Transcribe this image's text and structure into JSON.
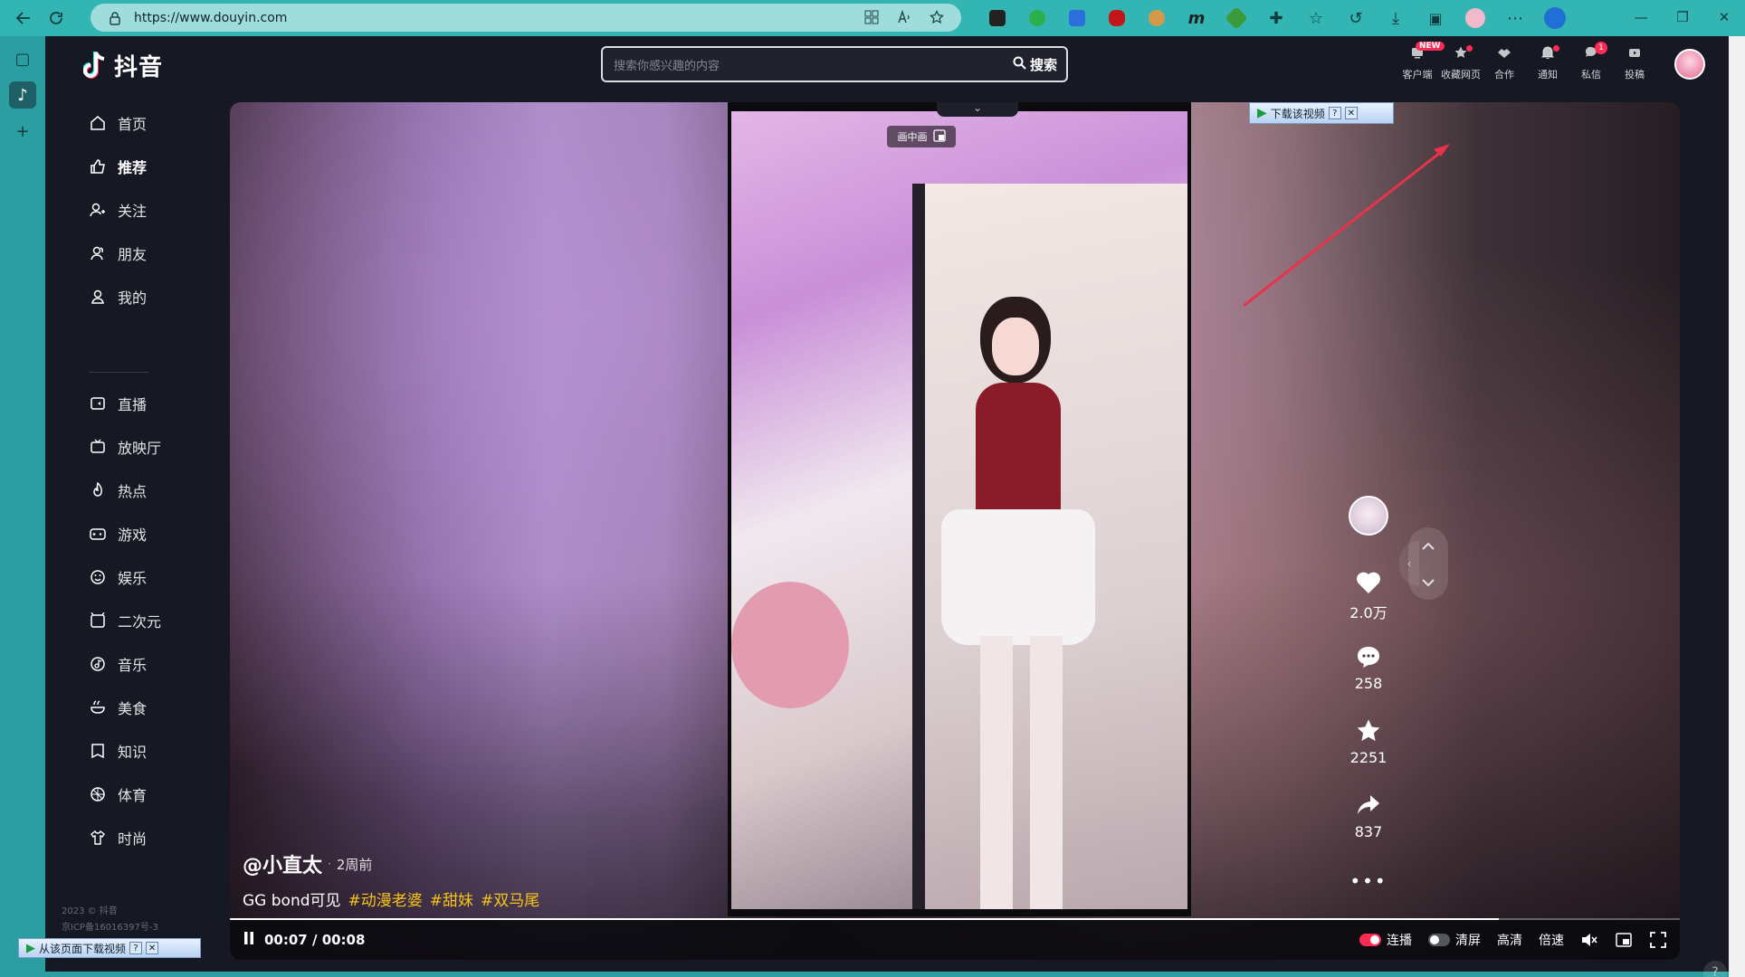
{
  "browser": {
    "url": "https://www.douyin.com"
  },
  "logo": {
    "text": "抖音"
  },
  "sidebar": {
    "items": [
      {
        "label": "首页",
        "icon": "home-icon"
      },
      {
        "label": "推荐",
        "icon": "thumbs-up-icon",
        "active": true
      },
      {
        "label": "关注",
        "icon": "follow-icon"
      },
      {
        "label": "朋友",
        "icon": "friends-icon"
      },
      {
        "label": "我的",
        "icon": "user-icon"
      },
      {
        "label": "直播",
        "icon": "live-icon"
      },
      {
        "label": "放映厅",
        "icon": "tv-icon"
      },
      {
        "label": "热点",
        "icon": "fire-icon"
      },
      {
        "label": "游戏",
        "icon": "gamepad-icon"
      },
      {
        "label": "娱乐",
        "icon": "smile-icon"
      },
      {
        "label": "二次元",
        "icon": "anime-icon"
      },
      {
        "label": "音乐",
        "icon": "music-icon"
      },
      {
        "label": "美食",
        "icon": "food-icon"
      },
      {
        "label": "知识",
        "icon": "book-icon"
      },
      {
        "label": "体育",
        "icon": "ball-icon"
      },
      {
        "label": "时尚",
        "icon": "shirt-icon"
      }
    ],
    "footer_line1": "2023 © 抖音",
    "footer_line2": "京ICP备16016397号-3"
  },
  "search": {
    "placeholder": "搜索你感兴趣的内容",
    "button_label": "搜索"
  },
  "header": {
    "items": [
      {
        "label": "客户端",
        "badge": "NEW"
      },
      {
        "label": "收藏网页",
        "badge_dot": true
      },
      {
        "label": "合作"
      },
      {
        "label": "通知",
        "badge_dot": true
      },
      {
        "label": "私信",
        "badge": "1"
      },
      {
        "label": "投稿"
      }
    ]
  },
  "video": {
    "pip_label": "画中画",
    "download_overlay": "下载该视频",
    "author": "@小直太",
    "posted": "2周前",
    "description": "GG bond可见",
    "hashtags": [
      "#动漫老婆",
      "#甜妹",
      "#双马尾"
    ],
    "stats": {
      "likes": "2.0万",
      "comments": "258",
      "favorites": "2251",
      "shares": "837"
    },
    "time_current": "00:07",
    "time_total": "00:08",
    "progress": 0.875,
    "controls": {
      "autoplay_label": "连播",
      "clear_label": "清屏",
      "quality_label": "高清",
      "speed_label": "倍速"
    }
  },
  "page_download": "从该页面下载视频",
  "colors": {
    "accent": "#fe2c55",
    "hashtag": "#f5c518",
    "browser": "#33b5b4",
    "app_bg": "#161823"
  }
}
